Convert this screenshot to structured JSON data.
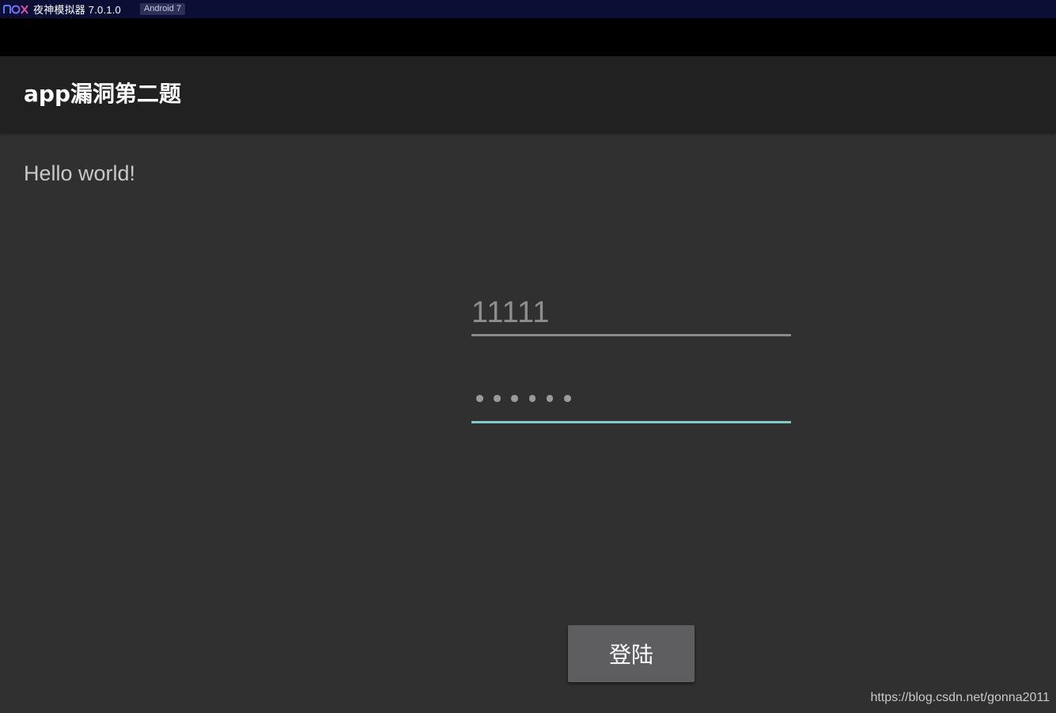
{
  "window": {
    "title": "夜神模拟器 7.0.1.0",
    "android_badge": "Android 7",
    "logo_icon": "nox-logo-icon"
  },
  "app": {
    "title": "app漏洞第二题"
  },
  "main": {
    "hello_text": "Hello world!",
    "username_value": "11111",
    "password_mask_count": 6,
    "login_label": "登陆"
  },
  "watermark": "https://blog.csdn.net/gonna2011",
  "colors": {
    "titlebar_bg": "#0b0f35",
    "statusbar_bg": "#000000",
    "appbar_bg": "#212121",
    "content_bg": "#303030",
    "accent_underline": "#80cbc4",
    "button_bg": "#5e5e60"
  }
}
